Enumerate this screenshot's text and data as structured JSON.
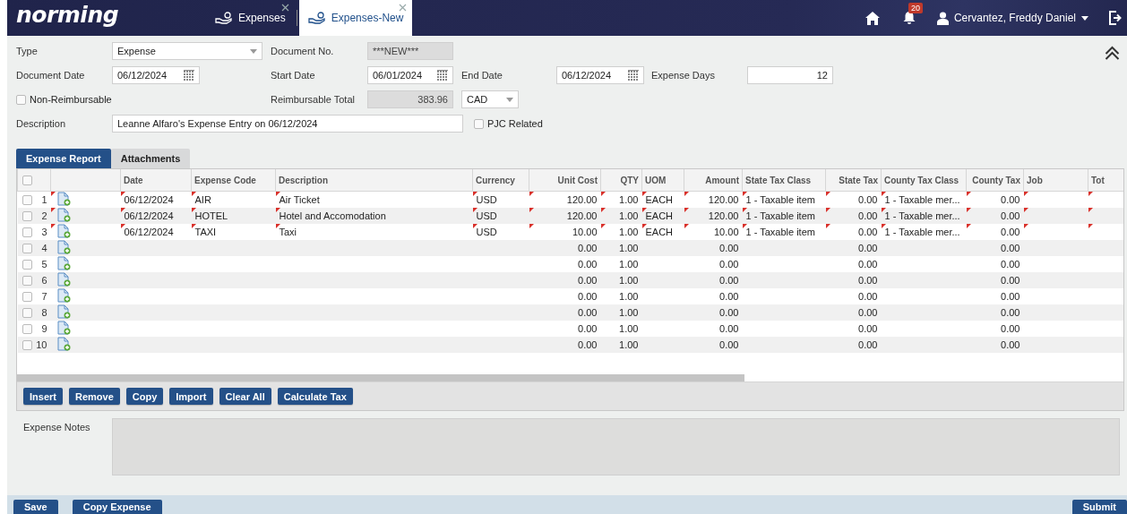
{
  "header": {
    "logo": "norming",
    "tabs": [
      {
        "label": "Expenses",
        "selected": false
      },
      {
        "label": "Expenses-New",
        "selected": true
      }
    ],
    "notifications": "20",
    "user": "Cervantez, Freddy Daniel"
  },
  "form": {
    "type": {
      "label": "Type",
      "value": "Expense"
    },
    "document_no": {
      "label": "Document No.",
      "value": "***NEW***",
      "disabled": true
    },
    "document_date": {
      "label": "Document Date",
      "value": "06/12/2024"
    },
    "start_date": {
      "label": "Start Date",
      "value": "06/01/2024"
    },
    "end_date": {
      "label": "End Date",
      "value": "06/12/2024"
    },
    "expense_days": {
      "label": "Expense Days",
      "value": "12"
    },
    "non_reimbursable": {
      "label": "Non-Reimbursable",
      "checked": false
    },
    "reimbursable_total": {
      "label": "Reimbursable Total",
      "value": "383.96",
      "disabled": true
    },
    "currency": {
      "value": "CAD"
    },
    "description": {
      "label": "Description",
      "value": "Leanne Alfaro's Expense Entry on 06/12/2024"
    },
    "pjc_related": {
      "label": "PJC Related",
      "checked": false
    }
  },
  "report_tabs": [
    {
      "label": "Expense Report",
      "selected": true
    },
    {
      "label": "Attachments",
      "selected": false
    }
  ],
  "grid": {
    "select_all_checked": false,
    "columns": [
      "Date",
      "Expense Code",
      "Description",
      "Currency",
      "Unit Cost",
      "QTY",
      "UOM",
      "Amount",
      "State Tax Class",
      "State Tax",
      "County Tax Class",
      "County Tax",
      "Job",
      "Tot"
    ],
    "rows": [
      {
        "number": "1",
        "checked": false,
        "modified": true,
        "cells": [
          "06/12/2024",
          "AIR",
          "Air Ticket",
          "USD",
          "120.00",
          "1.00",
          "EACH",
          "120.00",
          "1 - Taxable item",
          "0.00",
          "1 - Taxable mer...",
          "0.00",
          null,
          null
        ]
      },
      {
        "number": "2",
        "checked": false,
        "modified": true,
        "cells": [
          "06/12/2024",
          "HOTEL",
          "Hotel and Accomodation",
          "USD",
          "120.00",
          "1.00",
          "EACH",
          "120.00",
          "1 - Taxable item",
          "0.00",
          "1 - Taxable mer...",
          "0.00",
          null,
          null
        ]
      },
      {
        "number": "3",
        "checked": false,
        "modified": true,
        "cells": [
          "06/12/2024",
          "TAXI",
          "Taxi",
          "USD",
          "10.00",
          "1.00",
          "EACH",
          "10.00",
          "1 - Taxable item",
          "0.00",
          "1 - Taxable mer...",
          "0.00",
          null,
          null
        ]
      },
      {
        "number": "4",
        "checked": false,
        "modified": false,
        "cells": [
          null,
          null,
          null,
          null,
          "0.00",
          "1.00",
          null,
          "0.00",
          null,
          "0.00",
          null,
          "0.00",
          null,
          null
        ]
      },
      {
        "number": "5",
        "checked": false,
        "modified": false,
        "cells": [
          null,
          null,
          null,
          null,
          "0.00",
          "1.00",
          null,
          "0.00",
          null,
          "0.00",
          null,
          "0.00",
          null,
          null
        ]
      },
      {
        "number": "6",
        "checked": false,
        "modified": false,
        "cells": [
          null,
          null,
          null,
          null,
          "0.00",
          "1.00",
          null,
          "0.00",
          null,
          "0.00",
          null,
          "0.00",
          null,
          null
        ]
      },
      {
        "number": "7",
        "checked": false,
        "modified": false,
        "cells": [
          null,
          null,
          null,
          null,
          "0.00",
          "1.00",
          null,
          "0.00",
          null,
          "0.00",
          null,
          "0.00",
          null,
          null
        ]
      },
      {
        "number": "8",
        "checked": false,
        "modified": false,
        "cells": [
          null,
          null,
          null,
          null,
          "0.00",
          "1.00",
          null,
          "0.00",
          null,
          "0.00",
          null,
          "0.00",
          null,
          null
        ]
      },
      {
        "number": "9",
        "checked": false,
        "modified": false,
        "cells": [
          null,
          null,
          null,
          null,
          "0.00",
          "1.00",
          null,
          "0.00",
          null,
          "0.00",
          null,
          "0.00",
          null,
          null
        ]
      },
      {
        "number": "10",
        "checked": false,
        "modified": false,
        "cells": [
          null,
          null,
          null,
          null,
          "0.00",
          "1.00",
          null,
          "0.00",
          null,
          "0.00",
          null,
          "0.00",
          null,
          null
        ]
      }
    ]
  },
  "toolbar_buttons": [
    "Insert",
    "Remove",
    "Copy",
    "Import",
    "Clear All",
    "Calculate Tax"
  ],
  "notes": {
    "label": "Expense Notes",
    "disabled": true
  },
  "footer": {
    "left_buttons": [
      "Save",
      "Copy Expense"
    ],
    "right_buttons": [
      "Submit"
    ]
  }
}
